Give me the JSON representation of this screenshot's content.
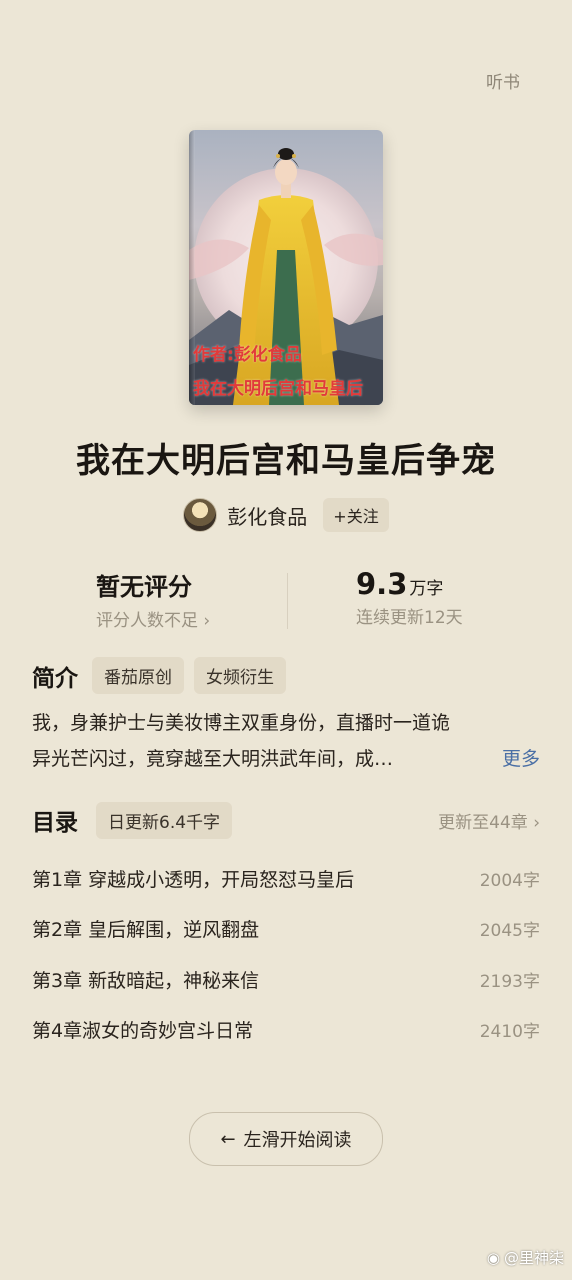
{
  "header": {
    "listen_label": "听书"
  },
  "cover": {
    "line1": "作者:彭化食品",
    "line2": "我在大明后宫和马皇后"
  },
  "book": {
    "title": "我在大明后宫和马皇后争宠"
  },
  "author": {
    "name": "彭化食品",
    "follow_label": "+关注"
  },
  "stats": {
    "rating": "暂无评分",
    "rating_sub": "评分人数不足 ›",
    "wordcount_value": "9.3",
    "wordcount_unit": "万字",
    "update_days": "连续更新12天"
  },
  "intro": {
    "title": "简介",
    "tags": [
      "番茄原创",
      "女频衍生"
    ],
    "line1": "我，身兼护士与美妆博主双重身份，直播时一道诡",
    "line2": "异光芒闪过，竟穿越至大明洪武年间，成…",
    "more_label": "更多"
  },
  "toc": {
    "title": "目录",
    "daily_update": "日更新6.4千字",
    "latest": "更新至44章 ›",
    "chapters": [
      {
        "title": "第1章 穿越成小透明，开局怒怼马皇后",
        "count": "2004字"
      },
      {
        "title": "第2章 皇后解围，逆风翻盘",
        "count": "2045字"
      },
      {
        "title": "第3章 新敌暗起，神秘来信",
        "count": "2193字"
      },
      {
        "title": "第4章淑女的奇妙宫斗日常",
        "count": "2410字"
      }
    ]
  },
  "read_button": {
    "arrow": "←",
    "label": "左滑开始阅读"
  },
  "watermark": {
    "text": "@里神柒"
  },
  "colors": {
    "background": "#ece6d6",
    "link": "#4a6fa5",
    "cover_text": "#e23a3a"
  }
}
